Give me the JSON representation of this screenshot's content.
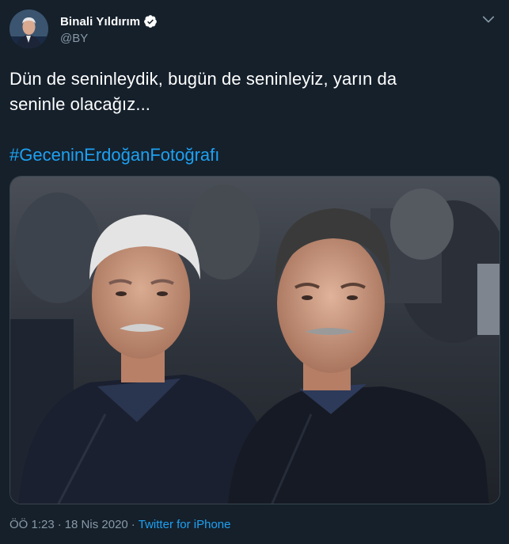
{
  "author": {
    "display_name": "Binali Yıldırım",
    "handle": "@BY",
    "verified": true,
    "avatar_icon": "profile-photo"
  },
  "tweet": {
    "text_line1": "Dün de seninleydik, bugün de seninleyiz, yarın da",
    "text_line2": "seninle olacağız...",
    "hashtag": "#GeceninErdoğanFotoğrafı"
  },
  "meta": {
    "time": "ÖÖ 1:23",
    "separator": "·",
    "date": "18 Nis 2020",
    "source": "Twitter for iPhone"
  },
  "colors": {
    "background": "#15202b",
    "text": "#ffffff",
    "secondary": "#8899a6",
    "accent": "#1da1f2"
  }
}
